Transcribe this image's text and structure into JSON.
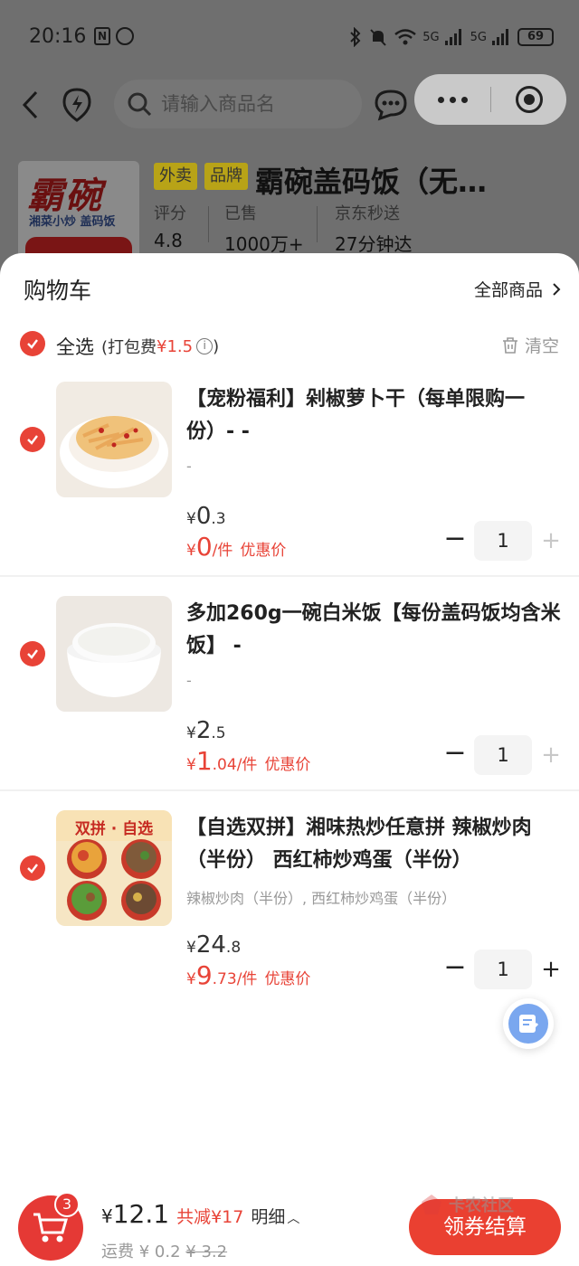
{
  "status_bar": {
    "time": "20:16",
    "network_label_1": "5G",
    "network_label_2": "5G",
    "battery": "69"
  },
  "top_nav": {
    "search_placeholder": "请输入商品名"
  },
  "store": {
    "logo_text": "霸碗",
    "logo_subtitle": "湘菜小炒 盖码饭",
    "tags": [
      "外卖",
      "品牌"
    ],
    "name": "霸碗盖码饭（无…",
    "stats": [
      {
        "label": "评分",
        "value": "4.8"
      },
      {
        "label": "已售",
        "value": "1000万+"
      },
      {
        "label": "京东秒送",
        "value": "27分钟达"
      }
    ]
  },
  "cart": {
    "title": "购物车",
    "all_goods": "全部商品",
    "select_all": "全选",
    "pack_fee_prefix": "(打包费",
    "pack_fee_amount": "¥1.5",
    "pack_fee_suffix": ")",
    "clear": "清空",
    "items": [
      {
        "title": "【宠粉福利】剁椒萝卜干（每单限购一份）- -",
        "spec": "-",
        "orig_int": "0",
        "orig_dec": ".3",
        "deal_int": "0",
        "deal_dec": "",
        "unit": "/件",
        "deal_tag": "优惠价",
        "quantity": "1",
        "checked": true
      },
      {
        "title": "多加260g一碗白米饭【每份盖码饭均含米饭】 -",
        "spec": "-",
        "orig_int": "2",
        "orig_dec": ".5",
        "deal_int": "1",
        "deal_dec": ".04",
        "unit": "/件",
        "deal_tag": "优惠价",
        "quantity": "1",
        "checked": true
      },
      {
        "title": "【自选双拼】湘味热炒任意拼 辣椒炒肉（半份） 西红柿炒鸡蛋（半份）",
        "spec": "辣椒炒肉（半份）, 西红柿炒鸡蛋（半份）",
        "thumb_label": "双拼 · 自选",
        "orig_int": "24",
        "orig_dec": ".8",
        "deal_int": "9",
        "deal_dec": ".73",
        "unit": "/件",
        "deal_tag": "优惠价",
        "quantity": "1",
        "checked": true
      }
    ],
    "currency": "¥",
    "minus": "−",
    "plus": "+"
  },
  "bottom_bar": {
    "badge_count": "3",
    "total_currency": "¥",
    "total": "12.1",
    "discount": "共减¥17",
    "detail": "明细",
    "shipping_label": "运费",
    "shipping_fee": "¥ 0.2",
    "shipping_original": "¥ 3.2",
    "checkout": "领券结算",
    "watermark": "卡农社区"
  },
  "colors": {
    "accent": "#e84337",
    "checkout": "#ea4031",
    "overlay": "#6f6f6f"
  }
}
